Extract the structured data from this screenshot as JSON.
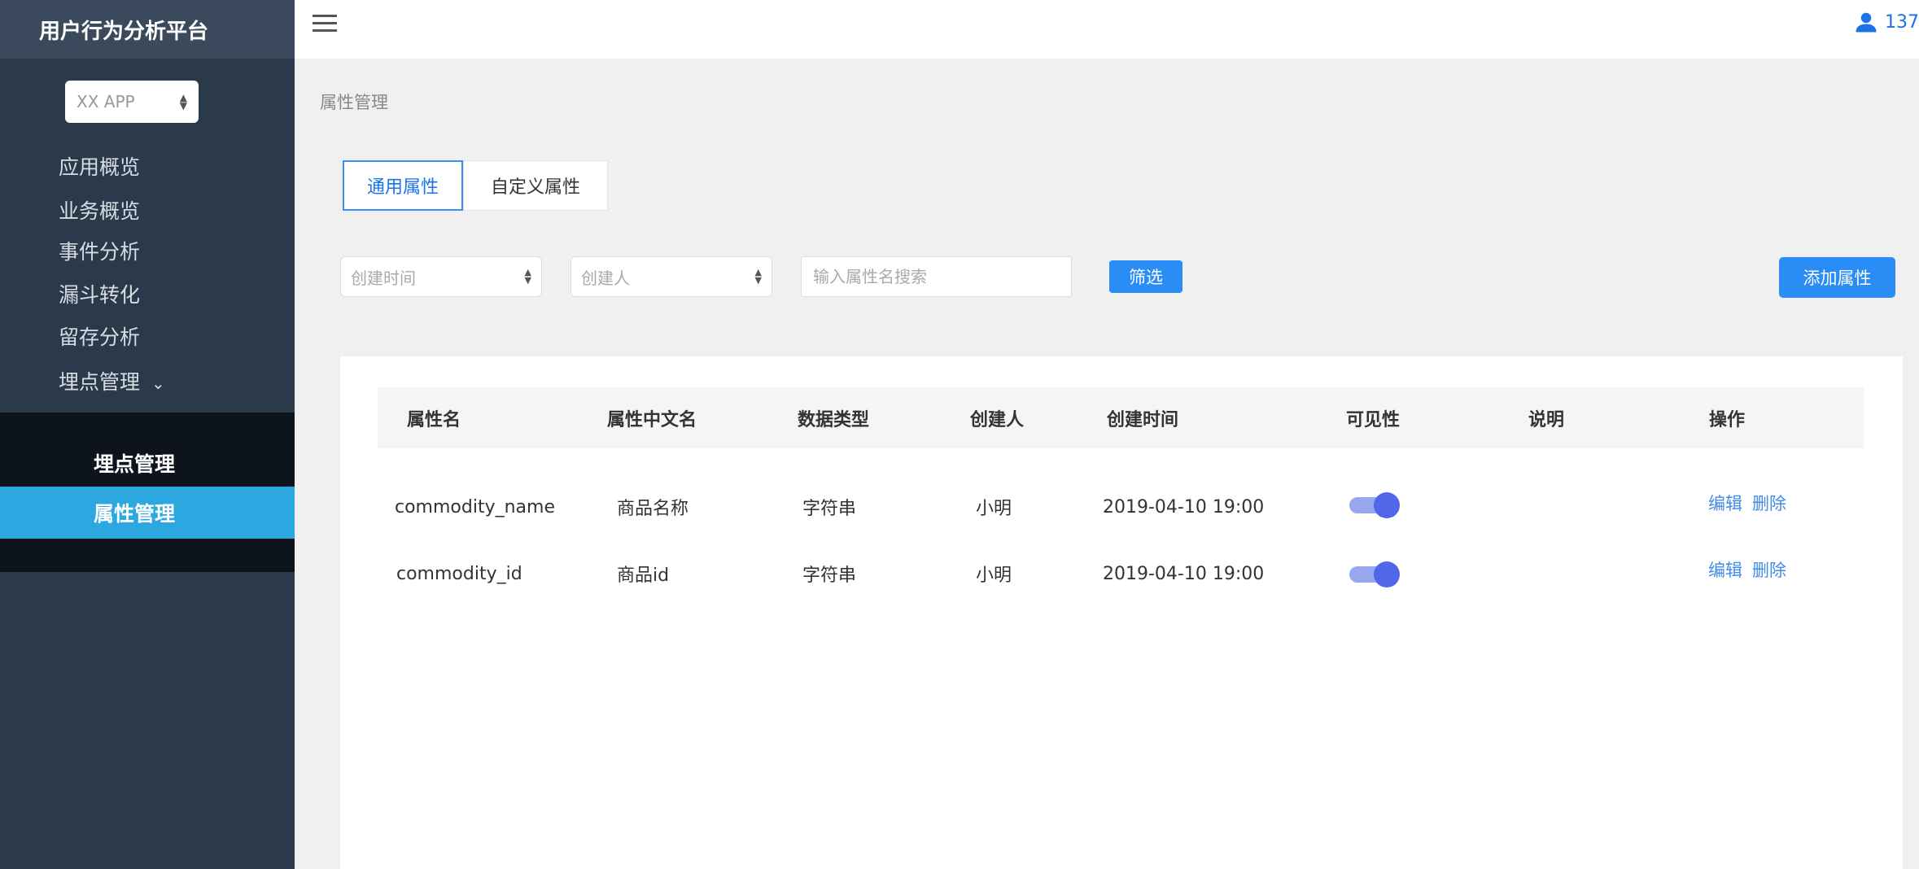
{
  "sidebar": {
    "title": "用户行为分析平台",
    "app_select": "XX APP",
    "menu": [
      "应用概览",
      "业务概览",
      "事件分析",
      "漏斗转化",
      "留存分析",
      "埋点管理"
    ],
    "submenu": [
      "埋点管理",
      "属性管理"
    ]
  },
  "header": {
    "user_text": "137"
  },
  "breadcrumb": "属性管理",
  "tabs": [
    "通用属性",
    "自定义属性"
  ],
  "filters": {
    "created_time_placeholder": "创建时间",
    "creator_placeholder": "创建人",
    "search_placeholder": "输入属性名搜索",
    "filter_button": "筛选",
    "add_button": "添加属性"
  },
  "table": {
    "headers": [
      "属性名",
      "属性中文名",
      "数据类型",
      "创建人",
      "创建时间",
      "可见性",
      "说明",
      "操作"
    ],
    "rows": [
      {
        "name": "commodity_name",
        "cn_name": "商品名称",
        "type": "字符串",
        "creator": "小明",
        "created": "2019-04-10 19:00",
        "visible": true,
        "desc": "",
        "actions": [
          "编辑",
          "删除"
        ]
      },
      {
        "name": "commodity_id",
        "cn_name": "商品id",
        "type": "字符串",
        "creator": "小明",
        "created": "2019-04-10 19:00",
        "visible": true,
        "desc": "",
        "actions": [
          "编辑",
          "删除"
        ]
      }
    ]
  },
  "colors": {
    "accent": "#2a8cf5",
    "sidebar_bg": "#2b3a4a",
    "active_item": "#2da7e0",
    "toggle": "#4f67e8"
  }
}
